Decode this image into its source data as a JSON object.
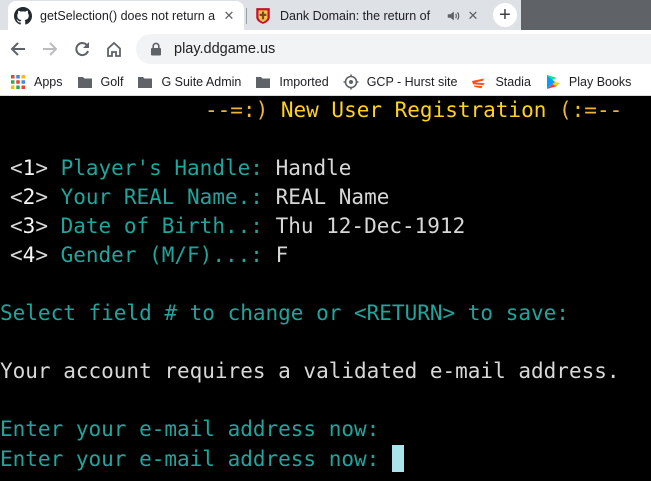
{
  "browser": {
    "tabs": [
      {
        "title": "getSelection() does not return a",
        "favicon": "github-icon",
        "active": true
      },
      {
        "title": "Dank Domain: the return of",
        "favicon": "dank-domain-icon",
        "active": false,
        "audio": true
      }
    ],
    "new_tab_label": "+",
    "close_label": "✕",
    "url": "play.ddgame.us"
  },
  "bookmarks": [
    {
      "label": "Apps",
      "icon": "apps-grid-icon"
    },
    {
      "label": "Golf",
      "icon": "folder-icon"
    },
    {
      "label": "G Suite Admin",
      "icon": "folder-icon"
    },
    {
      "label": "Imported",
      "icon": "folder-icon"
    },
    {
      "label": "GCP - Hurst site",
      "icon": "gcp-icon"
    },
    {
      "label": "Stadia",
      "icon": "stadia-icon"
    },
    {
      "label": "Play Books",
      "icon": "play-books-icon"
    }
  ],
  "terminal": {
    "title_prefix": "--=:) ",
    "title": "New User Registration",
    "title_suffix": " (:=--",
    "fields": [
      {
        "num": "1",
        "label": "Player's Handle:",
        "value": "Handle"
      },
      {
        "num": "2",
        "label": "Your REAL Name.:",
        "value": "REAL Name"
      },
      {
        "num": "3",
        "label": "Date of Birth..:",
        "value": "Thu 12-Dec-1912"
      },
      {
        "num": "4",
        "label": "Gender (M/F)...:",
        "value": "F"
      }
    ],
    "prompt": "Select field # to change or <RETURN> to save:",
    "notice": "Your account requires a validated e-mail address.",
    "email_prompt_1": "Enter your e-mail address now:",
    "email_prompt_2": "Enter your e-mail address now:"
  },
  "colors": {
    "terminal_bg": "#000000",
    "title_yellow": "#ffd21f",
    "title_orange": "#f0b43c",
    "teal": "#1ea59c",
    "text_white": "#d8d8d8",
    "cursor": "#a9e3ec"
  }
}
